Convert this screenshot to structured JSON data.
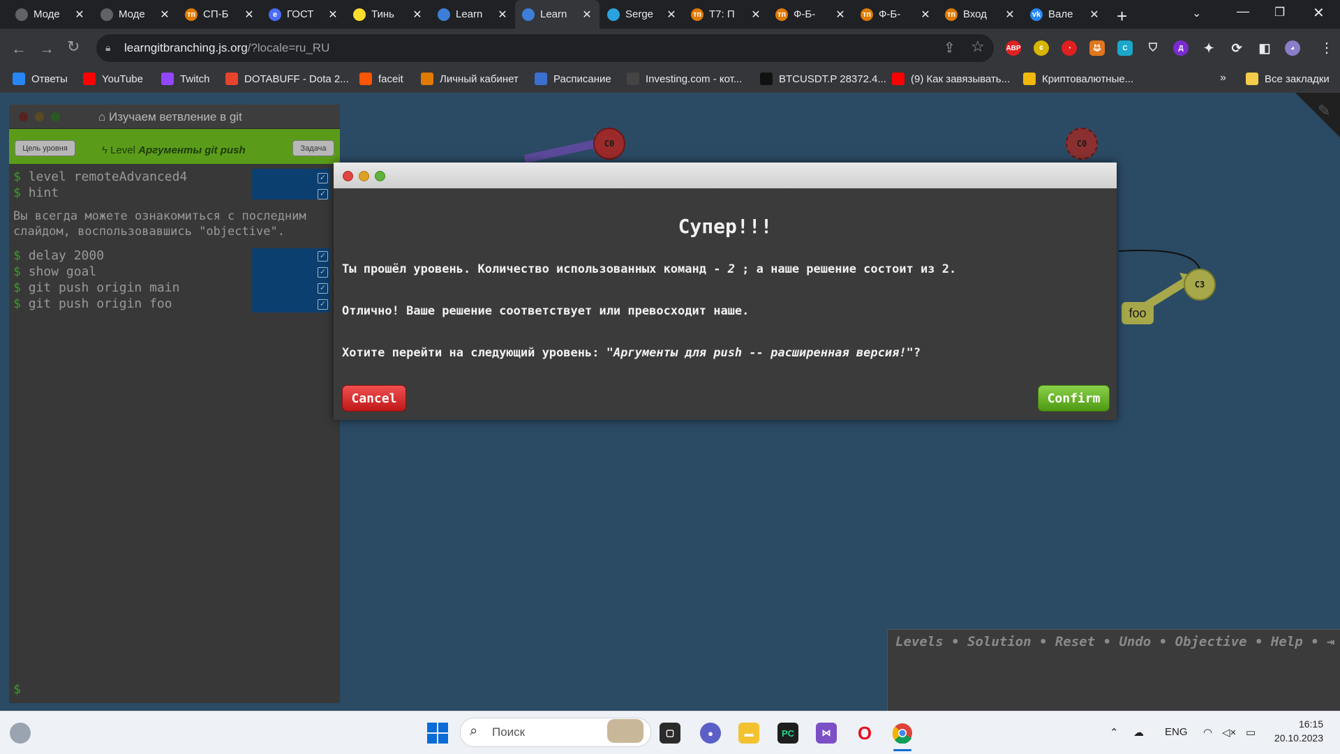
{
  "browser": {
    "tabs": [
      {
        "title": "Моде",
        "icon": "globe-icon",
        "color": "#5f6368",
        "letter": ""
      },
      {
        "title": "Моде",
        "icon": "globe-icon",
        "color": "#5f6368",
        "letter": ""
      },
      {
        "title": "СП-Б",
        "icon": "tn-icon",
        "color": "#e07b00",
        "letter": "тп"
      },
      {
        "title": "ГОСТ",
        "icon": "e-icon",
        "color": "#4a6cf7",
        "letter": "e"
      },
      {
        "title": "Тинь",
        "icon": "tinkoff-icon",
        "color": "#ffdd2d",
        "letter": ""
      },
      {
        "title": "Learn",
        "icon": "learngit-icon",
        "color": "#3d7fd8",
        "letter": ""
      },
      {
        "title": "Learn",
        "icon": "learngit-icon",
        "color": "#3d7fd8",
        "letter": ""
      },
      {
        "title": "Serge",
        "icon": "telegram-icon",
        "color": "#2aa3e0",
        "letter": ""
      },
      {
        "title": "T7: П",
        "icon": "tn-icon",
        "color": "#e07b00",
        "letter": "тп"
      },
      {
        "title": "Ф-Б-",
        "icon": "tn-icon",
        "color": "#e07b00",
        "letter": "тп"
      },
      {
        "title": "Ф-Б-",
        "icon": "tn-icon",
        "color": "#e07b00",
        "letter": "тп"
      },
      {
        "title": "Вход",
        "icon": "tn-icon",
        "color": "#e07b00",
        "letter": "тп"
      },
      {
        "title": "Вале",
        "icon": "vk-icon",
        "color": "#2787f5",
        "letter": "vk"
      }
    ],
    "new_tab_label": "+",
    "url_host": "learngitbranching.js.org",
    "url_path": "/?locale=ru_RU",
    "bookmarks": [
      {
        "label": "Ответы",
        "icon": "vk-icon",
        "color": "#2787f5"
      },
      {
        "label": "YouTube",
        "icon": "youtube-icon",
        "color": "#ff0000"
      },
      {
        "label": "Twitch",
        "icon": "twitch-icon",
        "color": "#9146ff"
      },
      {
        "label": "DOTABUFF - Dota 2...",
        "icon": "dotabuff-icon",
        "color": "#e8432d"
      },
      {
        "label": "faceit",
        "icon": "faceit-icon",
        "color": "#ff5500"
      },
      {
        "label": "Личный кабинет",
        "icon": "tn-icon",
        "color": "#e07b00"
      },
      {
        "label": "Расписание",
        "icon": "schedule-icon",
        "color": "#3b6fd0"
      },
      {
        "label": "Investing.com - кот...",
        "icon": "investing-icon",
        "color": "#444"
      },
      {
        "label": "BTCUSDT.P 28372.4...",
        "icon": "tradingview-icon",
        "color": "#111"
      },
      {
        "label": "(9) Как завязывать...",
        "icon": "youtube-icon",
        "color": "#ff0000"
      },
      {
        "label": "Криптовалютные...",
        "icon": "binance-icon",
        "color": "#f0b90b"
      }
    ],
    "bookmarks_more": "»",
    "all_bookmarks": "Все закладки"
  },
  "terminal": {
    "title": "Изучаем ветвление в git",
    "goal_button": "Цель уровня",
    "task_button": "Задача",
    "level_prefix": "Level",
    "level_name": "Аргументы git push",
    "lines": [
      "level remoteAdvanced4",
      "hint",
      "delay 2000",
      "show goal",
      "git push origin main",
      "git push origin foo"
    ],
    "hint_text_1": "Вы всегда можете ознакомиться с последним",
    "hint_text_2": "слайдом, воспользовавшись \"objective\".",
    "prompt": "$"
  },
  "graph": {
    "nodes": [
      "C0",
      "C0",
      "C3"
    ],
    "branch": "foo"
  },
  "modal": {
    "heading": "Супер!!!",
    "line1_a": "Ты прошёл уровень. Количество использованных команд - ",
    "line1_count": "2",
    "line1_b": " ; а наше решение состоит из 2.",
    "line2": "Отлично! Ваше решение соответствует или превосходит наше.",
    "line3_a": "Хотите перейти на следующий уровень: ",
    "line3_level": "\"Аргументы для push -- расширенная версия!\"",
    "line3_b": "?",
    "cancel": "Cancel",
    "confirm": "Confirm"
  },
  "commands": {
    "links": [
      "Levels",
      "Solution",
      "Reset",
      "Undo",
      "Objective",
      "Help"
    ],
    "sep": "•"
  },
  "taskbar": {
    "search_placeholder": "Поиск",
    "lang": "ENG",
    "time": "16:15",
    "date": "20.10.2023"
  }
}
